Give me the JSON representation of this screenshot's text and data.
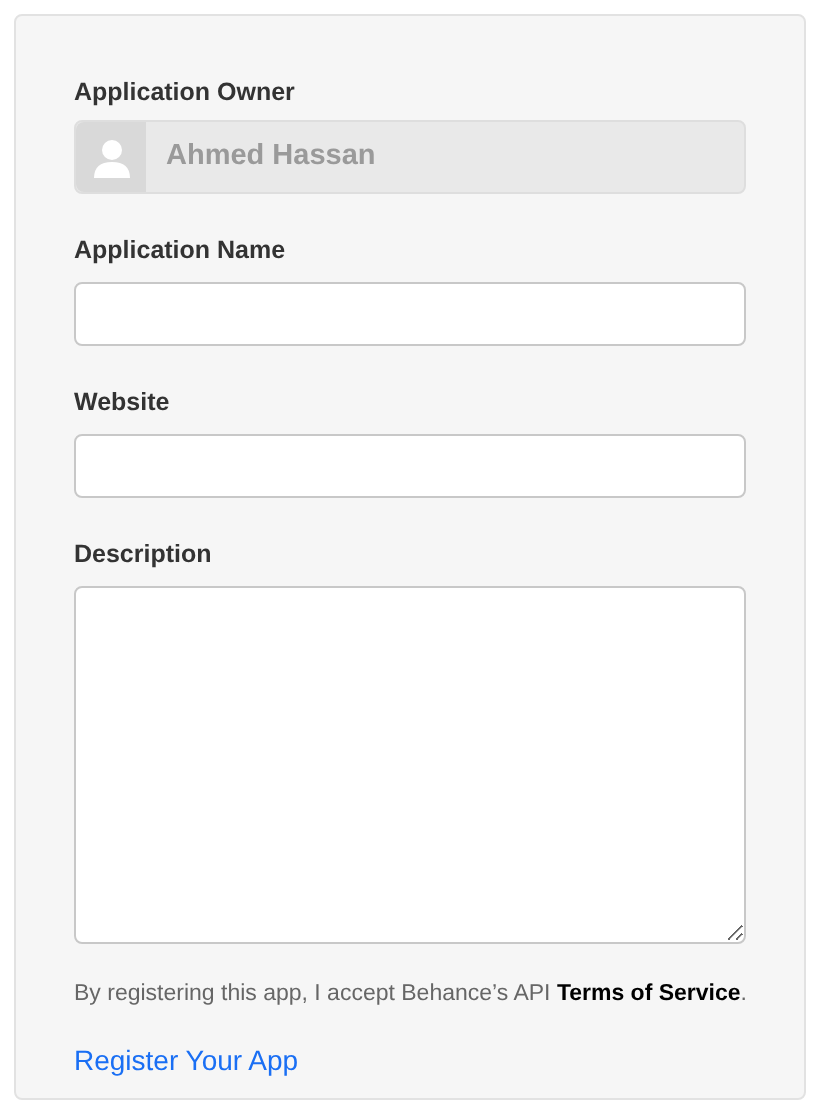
{
  "owner": {
    "label": "Application Owner",
    "value": "Ahmed Hassan",
    "disabled": true
  },
  "fields": [
    {
      "label": "Application Name",
      "kind": "input"
    },
    {
      "label": "Website",
      "kind": "input"
    },
    {
      "label": "Description",
      "kind": "textarea"
    }
  ],
  "terms": {
    "text": "By registering this app, I accept Behance’s API",
    "link": "Terms of Service",
    "end": "."
  },
  "submit": "Register Your App"
}
